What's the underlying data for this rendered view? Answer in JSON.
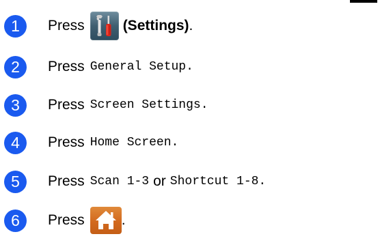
{
  "steps": [
    {
      "number": "1",
      "press": "Press",
      "label": "(Settings)",
      "end": ".",
      "icon": "settings-tools-icon"
    },
    {
      "number": "2",
      "press": "Press",
      "label": "General Setup",
      "end": "."
    },
    {
      "number": "3",
      "press": "Press",
      "label": "Screen Settings",
      "end": "."
    },
    {
      "number": "4",
      "press": "Press",
      "label": "Home Screen",
      "end": "."
    },
    {
      "number": "5",
      "press": "Press",
      "label": "Scan 1-3",
      "or": "or",
      "label2": "Shortcut 1-8",
      "end": "."
    },
    {
      "number": "6",
      "press": "Press",
      "end": ".",
      "icon": "home-icon"
    }
  ],
  "colors": {
    "badge": "#1a5aef",
    "settings_button": "#3f5e70",
    "home_button": "#d2691e"
  }
}
